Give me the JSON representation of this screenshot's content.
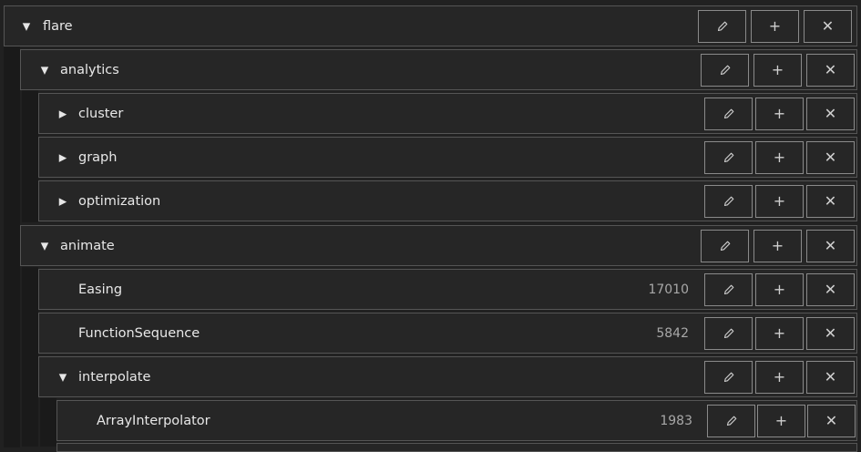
{
  "tree": {
    "nodes": [
      {
        "id": "flare",
        "label": "flare",
        "toggle": "▼",
        "value": ""
      },
      {
        "id": "analytics",
        "label": "analytics",
        "toggle": "▼",
        "value": ""
      },
      {
        "id": "cluster",
        "label": "cluster",
        "toggle": "▶",
        "value": ""
      },
      {
        "id": "graph",
        "label": "graph",
        "toggle": "▶",
        "value": ""
      },
      {
        "id": "optimization",
        "label": "optimization",
        "toggle": "▶",
        "value": ""
      },
      {
        "id": "animate",
        "label": "animate",
        "toggle": "▼",
        "value": ""
      },
      {
        "id": "easing",
        "label": "Easing",
        "toggle": "",
        "value": "17010"
      },
      {
        "id": "functionsequence",
        "label": "FunctionSequence",
        "toggle": "",
        "value": "5842"
      },
      {
        "id": "interpolate",
        "label": "interpolate",
        "toggle": "▼",
        "value": ""
      },
      {
        "id": "arrayinterpolator",
        "label": "ArrayInterpolator",
        "toggle": "",
        "value": "1983"
      }
    ],
    "icons": {
      "edit": "pencil-icon",
      "add": "plus-icon",
      "delete": "close-icon"
    },
    "add_glyph": "+",
    "delete_glyph": "✕"
  }
}
